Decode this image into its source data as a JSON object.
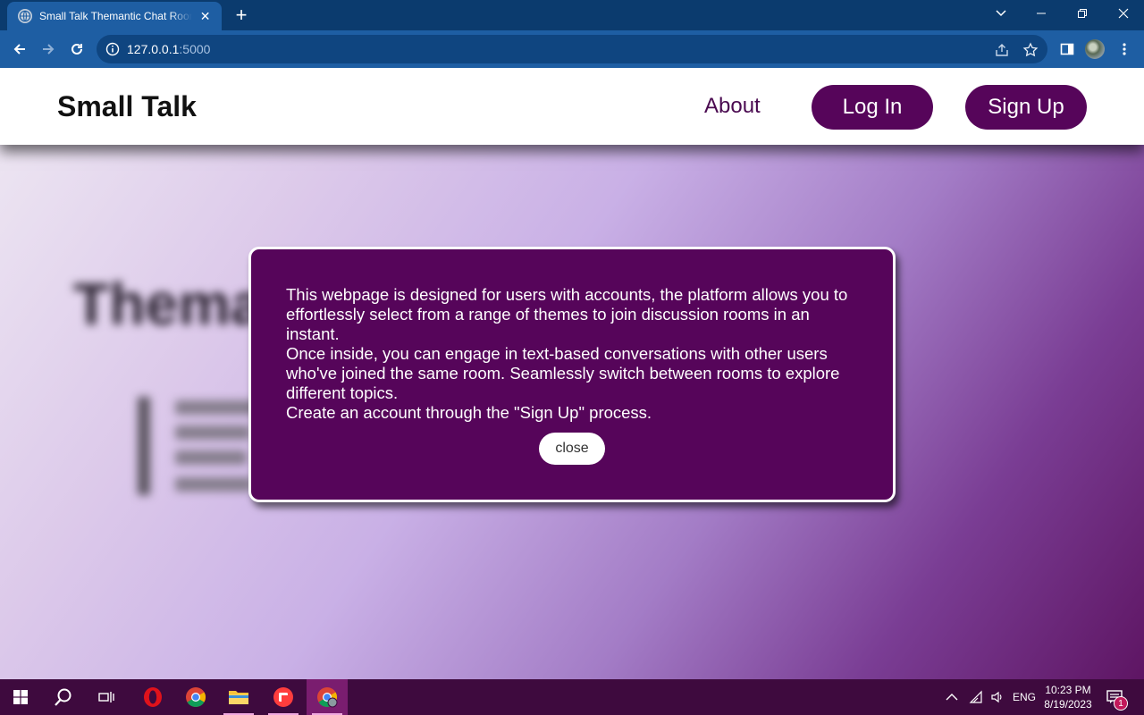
{
  "browser": {
    "tab_title": "Small Talk Themantic Chat Rooms",
    "url_host": "127.0.0.1",
    "url_port": ":5000"
  },
  "site": {
    "brand": "Small Talk",
    "nav": {
      "about": "About",
      "login": "Log In",
      "signup": "Sign Up"
    },
    "background_title": "Thema"
  },
  "modal": {
    "paragraphs": [
      "This webpage is designed for users with accounts, the platform allows you to effortlessly select from a range of themes to join discussion rooms in an instant.",
      "Once inside, you can engage in text-based conversations with other users who've joined the same room. Seamlessly switch between rooms to explore different topics.",
      "Create an account through the \"Sign Up\" process."
    ],
    "close_label": "close"
  },
  "taskbar": {
    "language": "ENG",
    "time": "10:23 PM",
    "date": "8/19/2023",
    "notification_count": "1"
  },
  "colors": {
    "accent": "#56055a",
    "browser_frame": "#0b3b6e",
    "browser_toolbar": "#1e5ea3",
    "taskbar": "#3e0a3e"
  }
}
